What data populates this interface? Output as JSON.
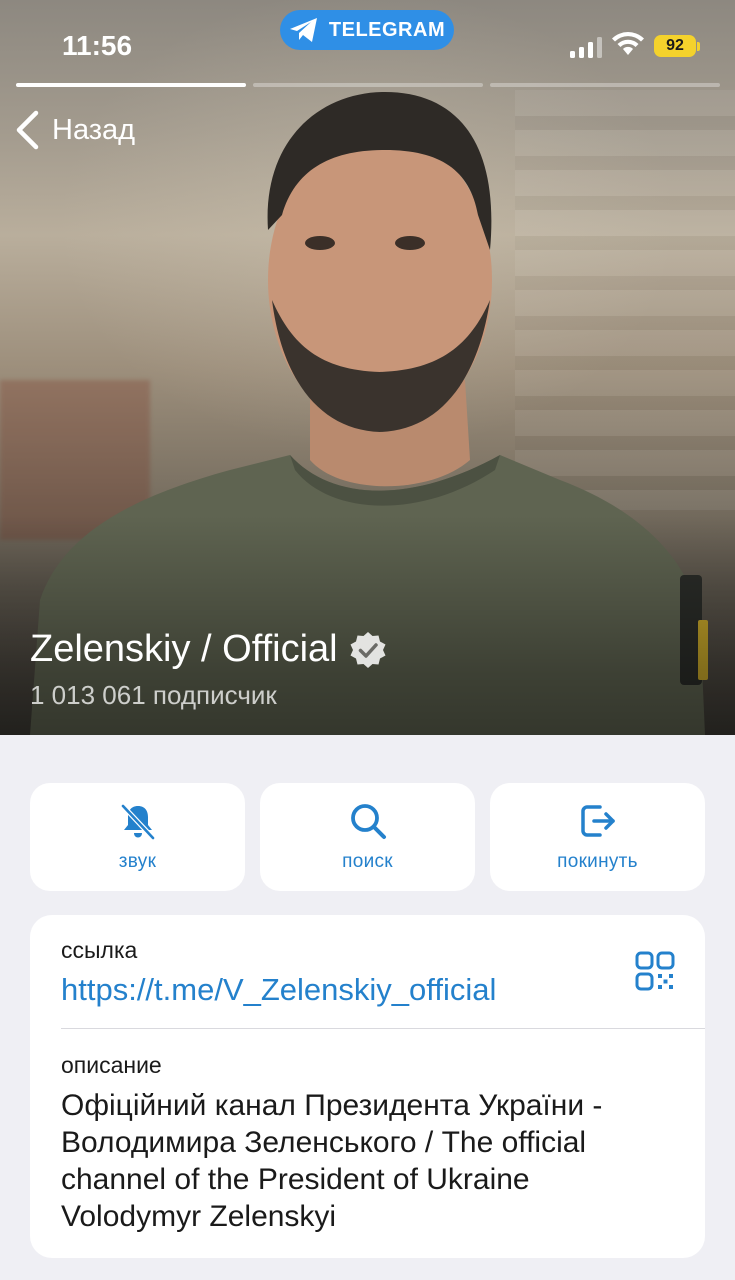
{
  "status_bar": {
    "time": "11:56",
    "app_pill": "TELEGRAM",
    "battery": "92"
  },
  "nav": {
    "back_label": "Назад"
  },
  "channel": {
    "name": "Zelenskiy / Official",
    "subscribers": "1 013 061 подписчик",
    "verified": true
  },
  "actions": [
    {
      "label": "звук",
      "icon": "bell-muted-icon"
    },
    {
      "label": "поиск",
      "icon": "search-icon"
    },
    {
      "label": "покинуть",
      "icon": "leave-icon"
    }
  ],
  "info": {
    "link_label": "ссылка",
    "link": "https://t.me/V_Zelenskiy_official",
    "description_label": "описание",
    "description": "Офіційний канал Президента України - Володимира Зеленського / The official channel of the President of Ukraine Volodymyr Zelenskyi"
  },
  "colors": {
    "accent": "#2481cc",
    "telegram_pill": "#2f8fe6",
    "battery": "#f4d22c",
    "background": "#efeff4"
  }
}
